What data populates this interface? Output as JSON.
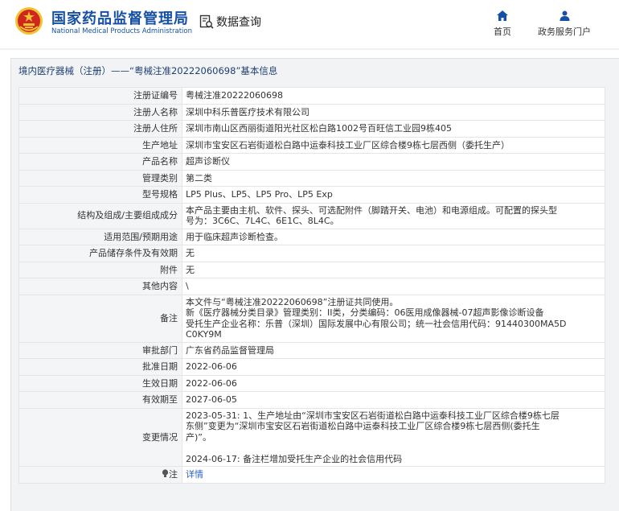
{
  "header": {
    "org_name_cn": "国家药品监督管理局",
    "org_name_en": "National Medical Products Administration",
    "query_label": "数据查询",
    "nav": [
      {
        "label": "首页",
        "icon": "home-icon"
      },
      {
        "label": "政务服务门户",
        "icon": "user-icon"
      }
    ],
    "colors": {
      "brand": "#1650a5",
      "emblem_red": "#d0261e",
      "emblem_gold": "#f1c232"
    }
  },
  "panel": {
    "title": "境内医疗器械（注册）——“粤械注准20222060698”基本信息"
  },
  "record": {
    "reg_no": {
      "label": "注册证编号",
      "value": "粤械注准20222060698"
    },
    "registrant": {
      "label": "注册人名称",
      "value": "深圳中科乐普医疗技术有限公司"
    },
    "registrant_addr": {
      "label": "注册人住所",
      "value": "深圳市南山区西丽街道阳光社区松白路1002号百旺信工业园9栋405"
    },
    "prod_addr": {
      "label": "生产地址",
      "value": "深圳市宝安区石岩街道松白路中运泰科技工业厂区综合楼9栋七层西侧（委托生产）"
    },
    "product_name": {
      "label": "产品名称",
      "value": "超声诊断仪"
    },
    "category": {
      "label": "管理类别",
      "value": "第二类"
    },
    "model": {
      "label": "型号规格",
      "value": "LP5 Plus、LP5、LP5 Pro、LP5 Exp"
    },
    "structure": {
      "label": "结构及组成/主要组成成分",
      "line1": "本产品主要由主机、软件、探头、可选配附件（脚踏开关、电池）和电源组成。可配置的探头型",
      "line2": "号为：3C6C、7L4C、6E1C、8L4C。"
    },
    "scope": {
      "label": "适用范围/预期用途",
      "value": "用于临床超声诊断检查。"
    },
    "storage": {
      "label": "产品储存条件及有效期",
      "value": "无"
    },
    "accessories": {
      "label": "附件",
      "value": "无"
    },
    "other": {
      "label": "其他内容",
      "value": "\\"
    },
    "remarks": {
      "label": "备注",
      "line1": "本文件与“粤械注准20222060698”注册证共同使用。",
      "line2": "新《医疗器械分类目录》管理类别：II类，分类编码：06医用成像器械-07超声影像诊断设备",
      "line3": "受托生产企业名称：乐普（深圳）国际发展中心有限公司；统一社会信用代码：91440300MA5D",
      "line4": "C0KY9M"
    },
    "approval_dept": {
      "label": "审批部门",
      "value": "广东省药品监督管理局"
    },
    "approval_date": {
      "label": "批准日期",
      "value": "2022-06-06"
    },
    "effective_date": {
      "label": "生效日期",
      "value": "2022-06-06"
    },
    "expiry_date": {
      "label": "有效期至",
      "value": "2027-06-05"
    },
    "changes": {
      "label": "变更情况",
      "line1": "2023-05-31: 1、生产地址由“深圳市宝安区石岩街道松白路中运泰科技工业厂区综合楼9栋七层",
      "line2": "东侧”变更为“深圳市宝安区石岩街道松白路中运泰科技工业厂区综合楼9栋七层西侧(委托生",
      "line3": "产)”。",
      "line4": "2024-06-17: 备注栏增加受托生产企业的社会信用代码"
    },
    "note": {
      "label": "注",
      "link": "详情",
      "icon": "bulb-icon"
    }
  }
}
